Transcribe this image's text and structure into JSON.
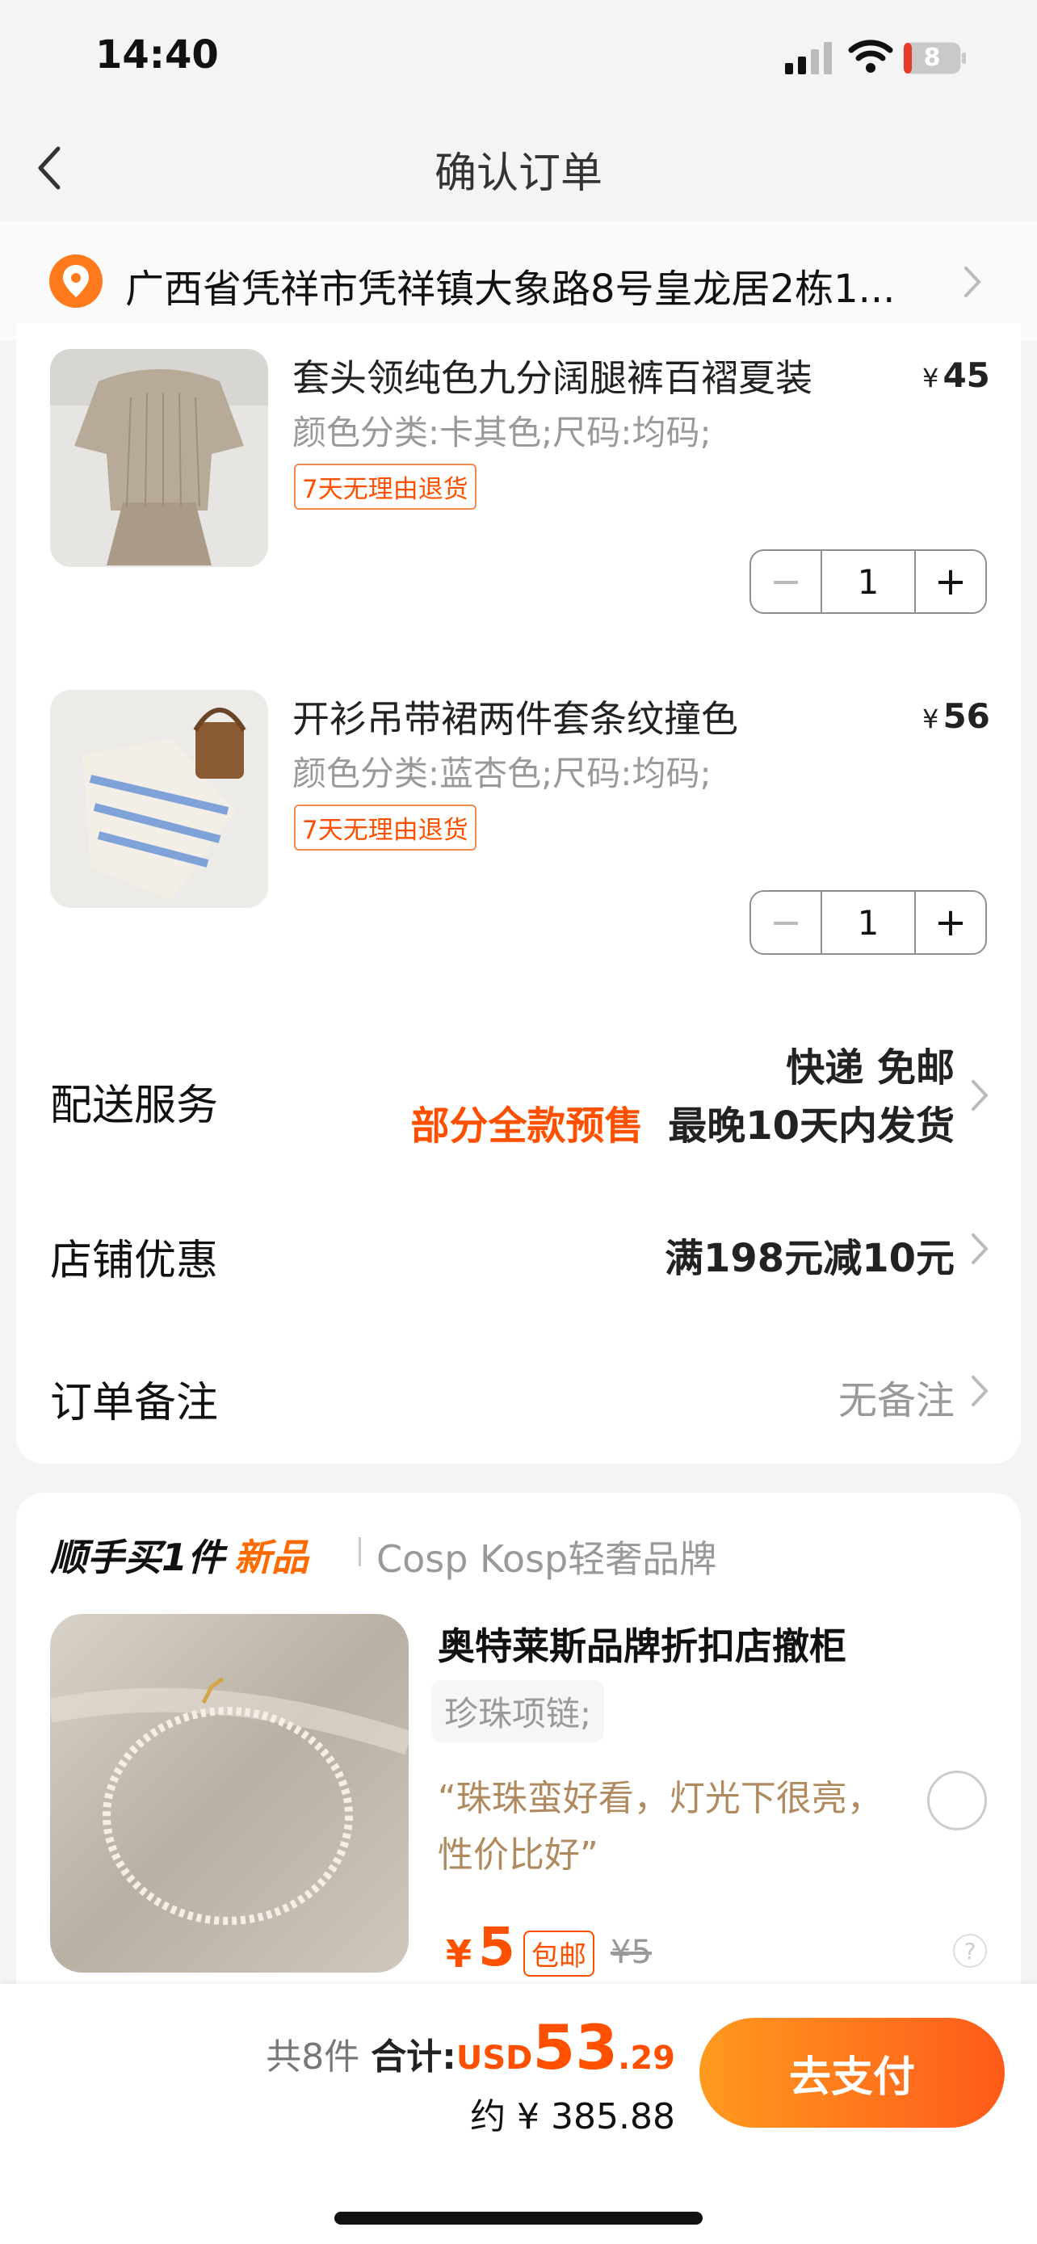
{
  "status_bar": {
    "time": "14:40",
    "battery": "8"
  },
  "nav": {
    "title": "确认订单"
  },
  "address": {
    "text": "广西省凭祥市凭祥镇大象路8号皇龙居2栋1..."
  },
  "items": [
    {
      "title": "套头领纯色九分阔腿裤百褶夏装",
      "spec": "颜色分类:卡其色;尺码:均码;",
      "badge": "7天无理由退货",
      "currency": "¥",
      "price": "45",
      "qty": "1"
    },
    {
      "title": "开衫吊带裙两件套条纹撞色",
      "spec": "颜色分类:蓝杏色;尺码:均码;",
      "badge": "7天无理由退货",
      "currency": "¥",
      "price": "56",
      "qty": "1"
    }
  ],
  "delivery": {
    "label": "配送服务",
    "line1": "快递 免邮",
    "presale": "部分全款预售",
    "ship_time": "最晚10天内发货"
  },
  "discount": {
    "label": "店铺优惠",
    "value": "满198元减10元"
  },
  "remark": {
    "label": "订单备注",
    "value": "无备注"
  },
  "recommend": {
    "heading": "顺手买1件",
    "new_label": "新品",
    "brand": "Cosp Kosp轻奢品牌",
    "title": "奥特莱斯品牌折扣店撤柜",
    "tag": "珍珠项链;",
    "quote": "“珠珠蛮好看，灯光下很亮，性价比好”",
    "currency": "¥",
    "price": "5",
    "shipping": "包邮",
    "original_price": "¥5",
    "help": "?"
  },
  "footer": {
    "count": "共8件",
    "total_label": "合计:",
    "currency": "USD",
    "amount_int": "53",
    "amount_dec": ".29",
    "approx": "约 ¥ 385.88",
    "pay": "去支付"
  },
  "colors": {
    "accent": "#ff5000",
    "brand_orange": "#ff8a1f",
    "quote_brown": "#b08a5f"
  }
}
